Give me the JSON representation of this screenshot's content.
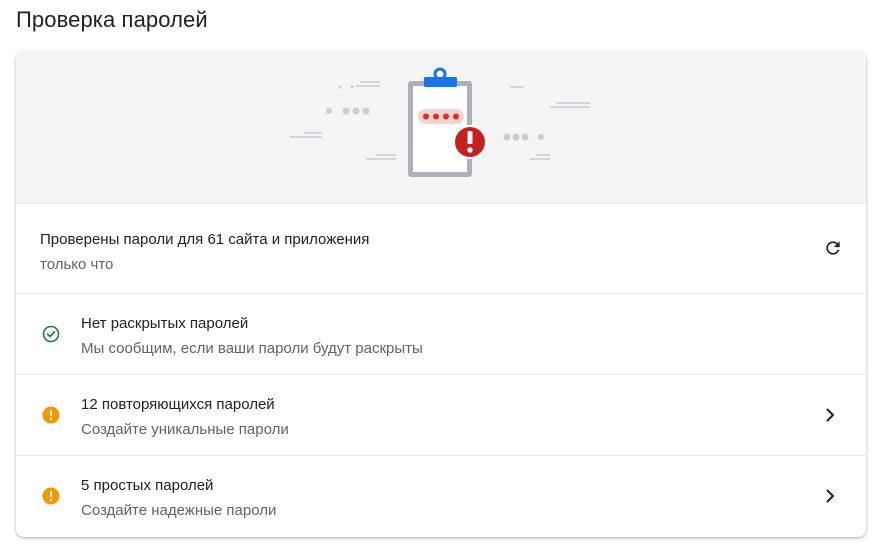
{
  "page": {
    "title": "Проверка паролей"
  },
  "status": {
    "summary": "Проверены пароли для 61 сайта и приложения",
    "time": "только что",
    "refresh_icon": "refresh-icon"
  },
  "checks": [
    {
      "title": "Нет раскрытых паролей",
      "subtitle": "Мы сообщим, если ваши пароли будут раскрыты",
      "icon": "check-circle-icon",
      "color": "#188038"
    },
    {
      "title": "12 повторяющихся паролей",
      "subtitle": "Создайте уникальные пароли",
      "icon": "warning-circle-icon",
      "color": "#f29900"
    },
    {
      "title": "5 простых паролей",
      "subtitle": "Создайте надежные пароли",
      "icon": "warning-circle-icon",
      "color": "#f29900"
    }
  ],
  "colors": {
    "banner_bg": "#f4f5f6",
    "clip_blue": "#1a73e8",
    "alert_red": "#c5221f",
    "dot_red": "#d93025"
  }
}
